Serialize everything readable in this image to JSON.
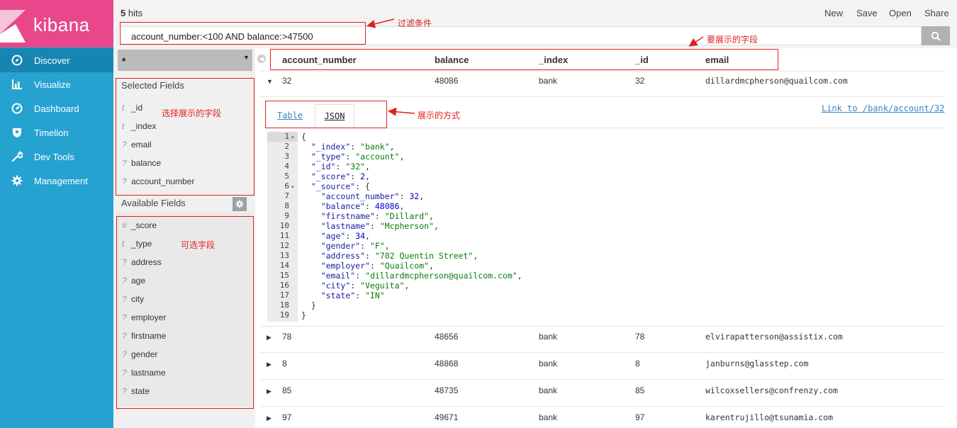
{
  "app": {
    "name": "kibana"
  },
  "nav": {
    "items": [
      {
        "label": "Discover",
        "icon": "compass-icon"
      },
      {
        "label": "Visualize",
        "icon": "bar-chart-icon"
      },
      {
        "label": "Dashboard",
        "icon": "gauge-icon"
      },
      {
        "label": "Timelion",
        "icon": "shield-icon"
      },
      {
        "label": "Dev Tools",
        "icon": "wrench-icon"
      },
      {
        "label": "Management",
        "icon": "gear-icon"
      }
    ]
  },
  "topbar": {
    "hits_count": "5",
    "hits_label": "hits",
    "actions": [
      "New",
      "Save",
      "Open",
      "Share"
    ]
  },
  "query": {
    "text": "account_number:<100 AND balance:>47500"
  },
  "index_pattern": {
    "label": "*"
  },
  "selected_fields": {
    "title": "Selected Fields",
    "fields": [
      {
        "type": "t",
        "name": "_id"
      },
      {
        "type": "t",
        "name": "_index"
      },
      {
        "type": "?",
        "name": "email"
      },
      {
        "type": "?",
        "name": "balance"
      },
      {
        "type": "?",
        "name": "account_number"
      }
    ]
  },
  "available_fields": {
    "title": "Available Fields",
    "fields": [
      {
        "type": "#",
        "name": "_score"
      },
      {
        "type": "t",
        "name": "_type"
      },
      {
        "type": "?",
        "name": "address"
      },
      {
        "type": "?",
        "name": "age"
      },
      {
        "type": "?",
        "name": "city"
      },
      {
        "type": "?",
        "name": "employer"
      },
      {
        "type": "?",
        "name": "firstname"
      },
      {
        "type": "?",
        "name": "gender"
      },
      {
        "type": "?",
        "name": "lastname"
      },
      {
        "type": "?",
        "name": "state"
      }
    ]
  },
  "table": {
    "columns": [
      "account_number",
      "balance",
      "_index",
      "_id",
      "email"
    ],
    "rows": [
      [
        "32",
        "48086",
        "bank",
        "32",
        "dillardmcpherson@quailcom.com"
      ],
      [
        "78",
        "48656",
        "bank",
        "78",
        "elvirapatterson@assistix.com"
      ],
      [
        "8",
        "48868",
        "bank",
        "8",
        "janburns@glasstep.com"
      ],
      [
        "85",
        "48735",
        "bank",
        "85",
        "wilcoxsellers@confrenzy.com"
      ],
      [
        "97",
        "49671",
        "bank",
        "97",
        "karentrujillo@tsunamia.com"
      ]
    ]
  },
  "detail": {
    "tabs": [
      "Table",
      "JSON"
    ],
    "link": "Link to /bank/account/32",
    "json_lines": [
      "{",
      "  \"_index\": \"bank\",",
      "  \"_type\": \"account\",",
      "  \"_id\": \"32\",",
      "  \"_score\": 2,",
      "  \"_source\": {",
      "    \"account_number\": 32,",
      "    \"balance\": 48086,",
      "    \"firstname\": \"Dillard\",",
      "    \"lastname\": \"Mcpherson\",",
      "    \"age\": 34,",
      "    \"gender\": \"F\",",
      "    \"address\": \"702 Quentin Street\",",
      "    \"employer\": \"Quailcom\",",
      "    \"email\": \"dillardmcpherson@quailcom.com\",",
      "    \"city\": \"Veguita\",",
      "    \"state\": \"IN\"",
      "  }",
      "}"
    ],
    "line_numbers": [
      "1",
      "2",
      "3",
      "4",
      "5",
      "6",
      "7",
      "8",
      "9",
      "10",
      "11",
      "12",
      "13",
      "14",
      "15",
      "16",
      "17",
      "18",
      "19"
    ]
  },
  "annotations": {
    "filter": "过滤条件",
    "fields_to_show": "要展示的字段",
    "choose_fields": "选择展示的字段",
    "display_mode": "展示的方式",
    "optional_fields": "可选字段"
  },
  "colors": {
    "brand_pink": "#e8488b",
    "nav_blue": "#26a2d0",
    "nav_active": "#1785b1",
    "link_blue": "#3a84c4",
    "annotation_red": "#e02020"
  }
}
